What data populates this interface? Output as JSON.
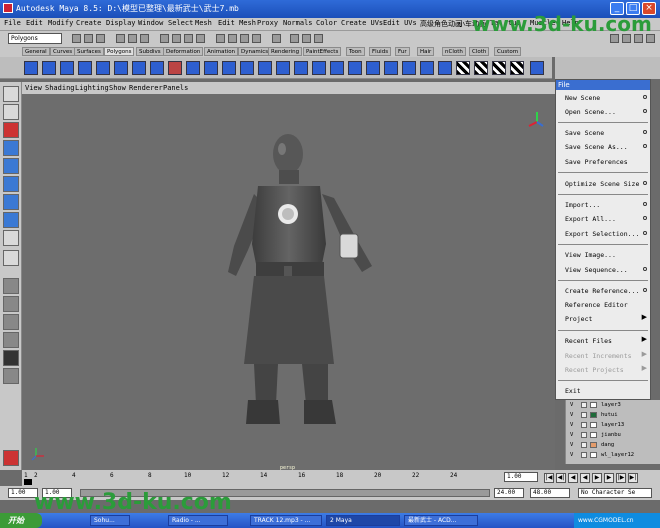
{
  "window": {
    "title": "Autodesk Maya 8.5: D:\\模型已整理\\最新武士\\武士7.mb",
    "minimize": "_",
    "maximize": "□",
    "close": "×"
  },
  "menubar": [
    "File",
    "Edit",
    "Modify",
    "Create",
    "Display",
    "Window",
    "Select",
    "Mesh",
    "Edit Mesh",
    "Proxy",
    "Normals",
    "Color",
    "Create UVs",
    "Edit UVs",
    "高级角色动画",
    "小车动画",
    "Ta",
    "tup",
    "Muscle",
    "Help"
  ],
  "status_line": {
    "mode": "Polygons"
  },
  "shelf_tabs": [
    "General",
    "Curves",
    "Surfaces",
    "Polygons",
    "Subdivs",
    "Deformation",
    "Animation",
    "Dynamics",
    "Rendering",
    "PaintEffects",
    "Toon",
    "Fluids",
    "Fur",
    "Hair",
    "nCloth",
    "Cloth",
    "Custom"
  ],
  "shelf_active": "Polygons",
  "viewport": {
    "menu": [
      "View",
      "Shading",
      "Lighting",
      "Show",
      "Renderer",
      "Panels"
    ],
    "camera_label": "persp",
    "axis": "z"
  },
  "file_menu": {
    "header": "File",
    "items": [
      {
        "label": "New Scene",
        "option": true,
        "disabled": false
      },
      {
        "label": "Open Scene...",
        "option": true,
        "disabled": false
      },
      {
        "label": "Save Scene",
        "option": true,
        "disabled": false
      },
      {
        "label": "Save Scene As...",
        "option": true,
        "disabled": false
      },
      {
        "label": "Save Preferences",
        "option": false,
        "disabled": false
      },
      {
        "label": "Optimize Scene Size",
        "option": true,
        "disabled": false
      },
      {
        "label": "Import...",
        "option": true,
        "disabled": false
      },
      {
        "label": "Export All...",
        "option": true,
        "disabled": false
      },
      {
        "label": "Export Selection...",
        "option": true,
        "disabled": false
      },
      {
        "label": "View Image...",
        "option": false,
        "disabled": false
      },
      {
        "label": "View Sequence...",
        "option": true,
        "disabled": false
      },
      {
        "label": "Create Reference...",
        "option": true,
        "disabled": false
      },
      {
        "label": "Reference Editor",
        "option": false,
        "disabled": false
      },
      {
        "label": "Project",
        "submenu": true,
        "disabled": false
      },
      {
        "label": "Recent Files",
        "submenu": true,
        "disabled": false
      },
      {
        "label": "Recent Increments",
        "submenu": true,
        "disabled": true
      },
      {
        "label": "Recent Projects",
        "submenu": true,
        "disabled": true
      },
      {
        "label": "Exit",
        "option": false,
        "disabled": false
      }
    ]
  },
  "layers": [
    {
      "visible": "V",
      "name": "layer3",
      "color": "#ffffff"
    },
    {
      "visible": "V",
      "name": "hutui",
      "color": "#1f6b3a"
    },
    {
      "visible": "V",
      "name": "layer13",
      "color": "#ffffff"
    },
    {
      "visible": "V",
      "name": "jianbu",
      "color": "#ffffff"
    },
    {
      "visible": "V",
      "name": "dang",
      "color": "#e39b6a"
    },
    {
      "visible": "V",
      "name": "wl_layer12",
      "color": "#ffffff"
    }
  ],
  "timeline": {
    "ticks": [
      "1",
      "2",
      "4",
      "6",
      "8",
      "10",
      "12",
      "14",
      "16",
      "18",
      "20",
      "22",
      "24"
    ],
    "current_frame": "1.00"
  },
  "range": {
    "start": "1.00",
    "start2": "1.00",
    "end": "24.00",
    "end2": "48.00",
    "character_set": "No Character Se"
  },
  "taskbar": {
    "start": "开始",
    "tasks": [
      "Sohu...",
      "Radio - ...",
      "TRACK 12.mp3 - ...",
      "2 Maya",
      "最新武士 - ACD..."
    ],
    "tray": "www.CGMODEL.cn"
  },
  "watermarks": {
    "top": "www.3d-ku.com",
    "bottom": "www.3d-ku.com"
  },
  "colors": {
    "title_bar": "#1b4fb9",
    "menu_bg": "#c8c8c8",
    "viewport_bg": "#6d6d6d",
    "selection": "#3a6ed0"
  }
}
